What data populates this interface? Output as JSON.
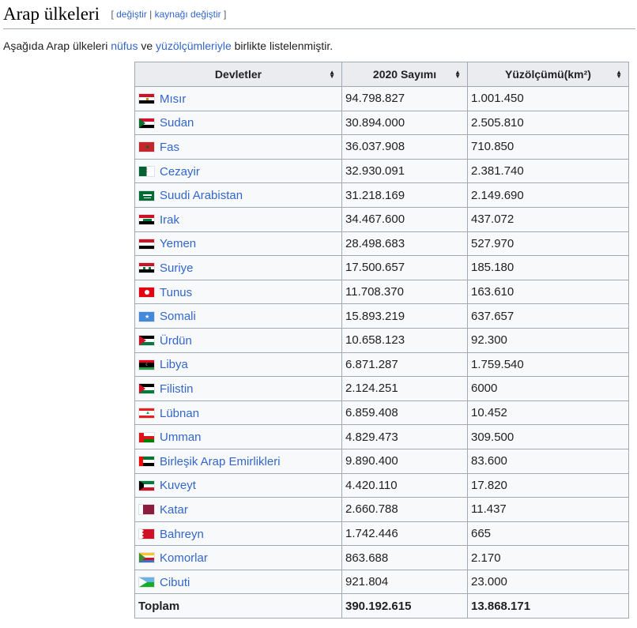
{
  "section": {
    "title": "Arap ülkeleri",
    "edit_label": "değiştir",
    "edit_source_label": "kaynağı değiştir",
    "bracket_open": "[",
    "separator": "|",
    "bracket_close": "]"
  },
  "intro": {
    "before": "Aşağıda Arap ülkeleri ",
    "link1": "nüfus",
    "middle": " ve ",
    "link2": "yüzölçümleriyle",
    "after": " birlikte listelenmiştir."
  },
  "table": {
    "headers": [
      "Devletler",
      "2020 Sayımı",
      "Yüzölçümü(km²)"
    ],
    "rows": [
      {
        "country": "Mısır",
        "population": "94.798.827",
        "area": "1.001.450",
        "flag": "egypt"
      },
      {
        "country": "Sudan",
        "population": "30.894.000",
        "area": "2.505.810",
        "flag": "sudan"
      },
      {
        "country": "Fas",
        "population": "36.037.908",
        "area": "710.850",
        "flag": "morocco"
      },
      {
        "country": "Cezayir",
        "population": "32.930.091",
        "area": "2.381.740",
        "flag": "algeria"
      },
      {
        "country": "Suudi Arabistan",
        "population": "31.218.169",
        "area": "2.149.690",
        "flag": "saudi"
      },
      {
        "country": "Irak",
        "population": "34.467.600",
        "area": "437.072",
        "flag": "iraq"
      },
      {
        "country": "Yemen",
        "population": "28.498.683",
        "area": "527.970",
        "flag": "yemen"
      },
      {
        "country": "Suriye",
        "population": "17.500.657",
        "area": "185.180",
        "flag": "syria"
      },
      {
        "country": "Tunus",
        "population": "11.708.370",
        "area": "163.610",
        "flag": "tunisia"
      },
      {
        "country": "Somali",
        "population": "15.893.219",
        "area": "637.657",
        "flag": "somalia"
      },
      {
        "country": "Ürdün",
        "population": "10.658.123",
        "area": "92.300",
        "flag": "jordan"
      },
      {
        "country": "Libya",
        "population": "6.871.287",
        "area": "1.759.540",
        "flag": "libya"
      },
      {
        "country": "Filistin",
        "population": "2.124.251",
        "area": "6000",
        "flag": "palestine"
      },
      {
        "country": "Lübnan",
        "population": "6.859.408",
        "area": "10.452",
        "flag": "lebanon"
      },
      {
        "country": "Umman",
        "population": "4.829.473",
        "area": "309.500",
        "flag": "oman"
      },
      {
        "country": "Birleşik Arap Emirlikleri",
        "population": "9.890.400",
        "area": "83.600",
        "flag": "uae"
      },
      {
        "country": "Kuveyt",
        "population": "4.420.110",
        "area": "17.820",
        "flag": "kuwait"
      },
      {
        "country": "Katar",
        "population": "2.660.788",
        "area": "11.437",
        "flag": "qatar"
      },
      {
        "country": "Bahreyn",
        "population": "1.742.446",
        "area": "665",
        "flag": "bahrain"
      },
      {
        "country": "Komorlar",
        "population": "863.688",
        "area": "2.170",
        "flag": "comoros"
      },
      {
        "country": "Cibuti",
        "population": "921.804",
        "area": "23.000",
        "flag": "djibouti"
      }
    ],
    "total": {
      "label": "Toplam",
      "population": "390.192.615",
      "area": "13.868.171"
    }
  },
  "colors": {
    "link": "#3366cc",
    "header_bg": "#eaecf0",
    "border": "#a2a9b1",
    "cell_bg": "#f8f9fa"
  }
}
